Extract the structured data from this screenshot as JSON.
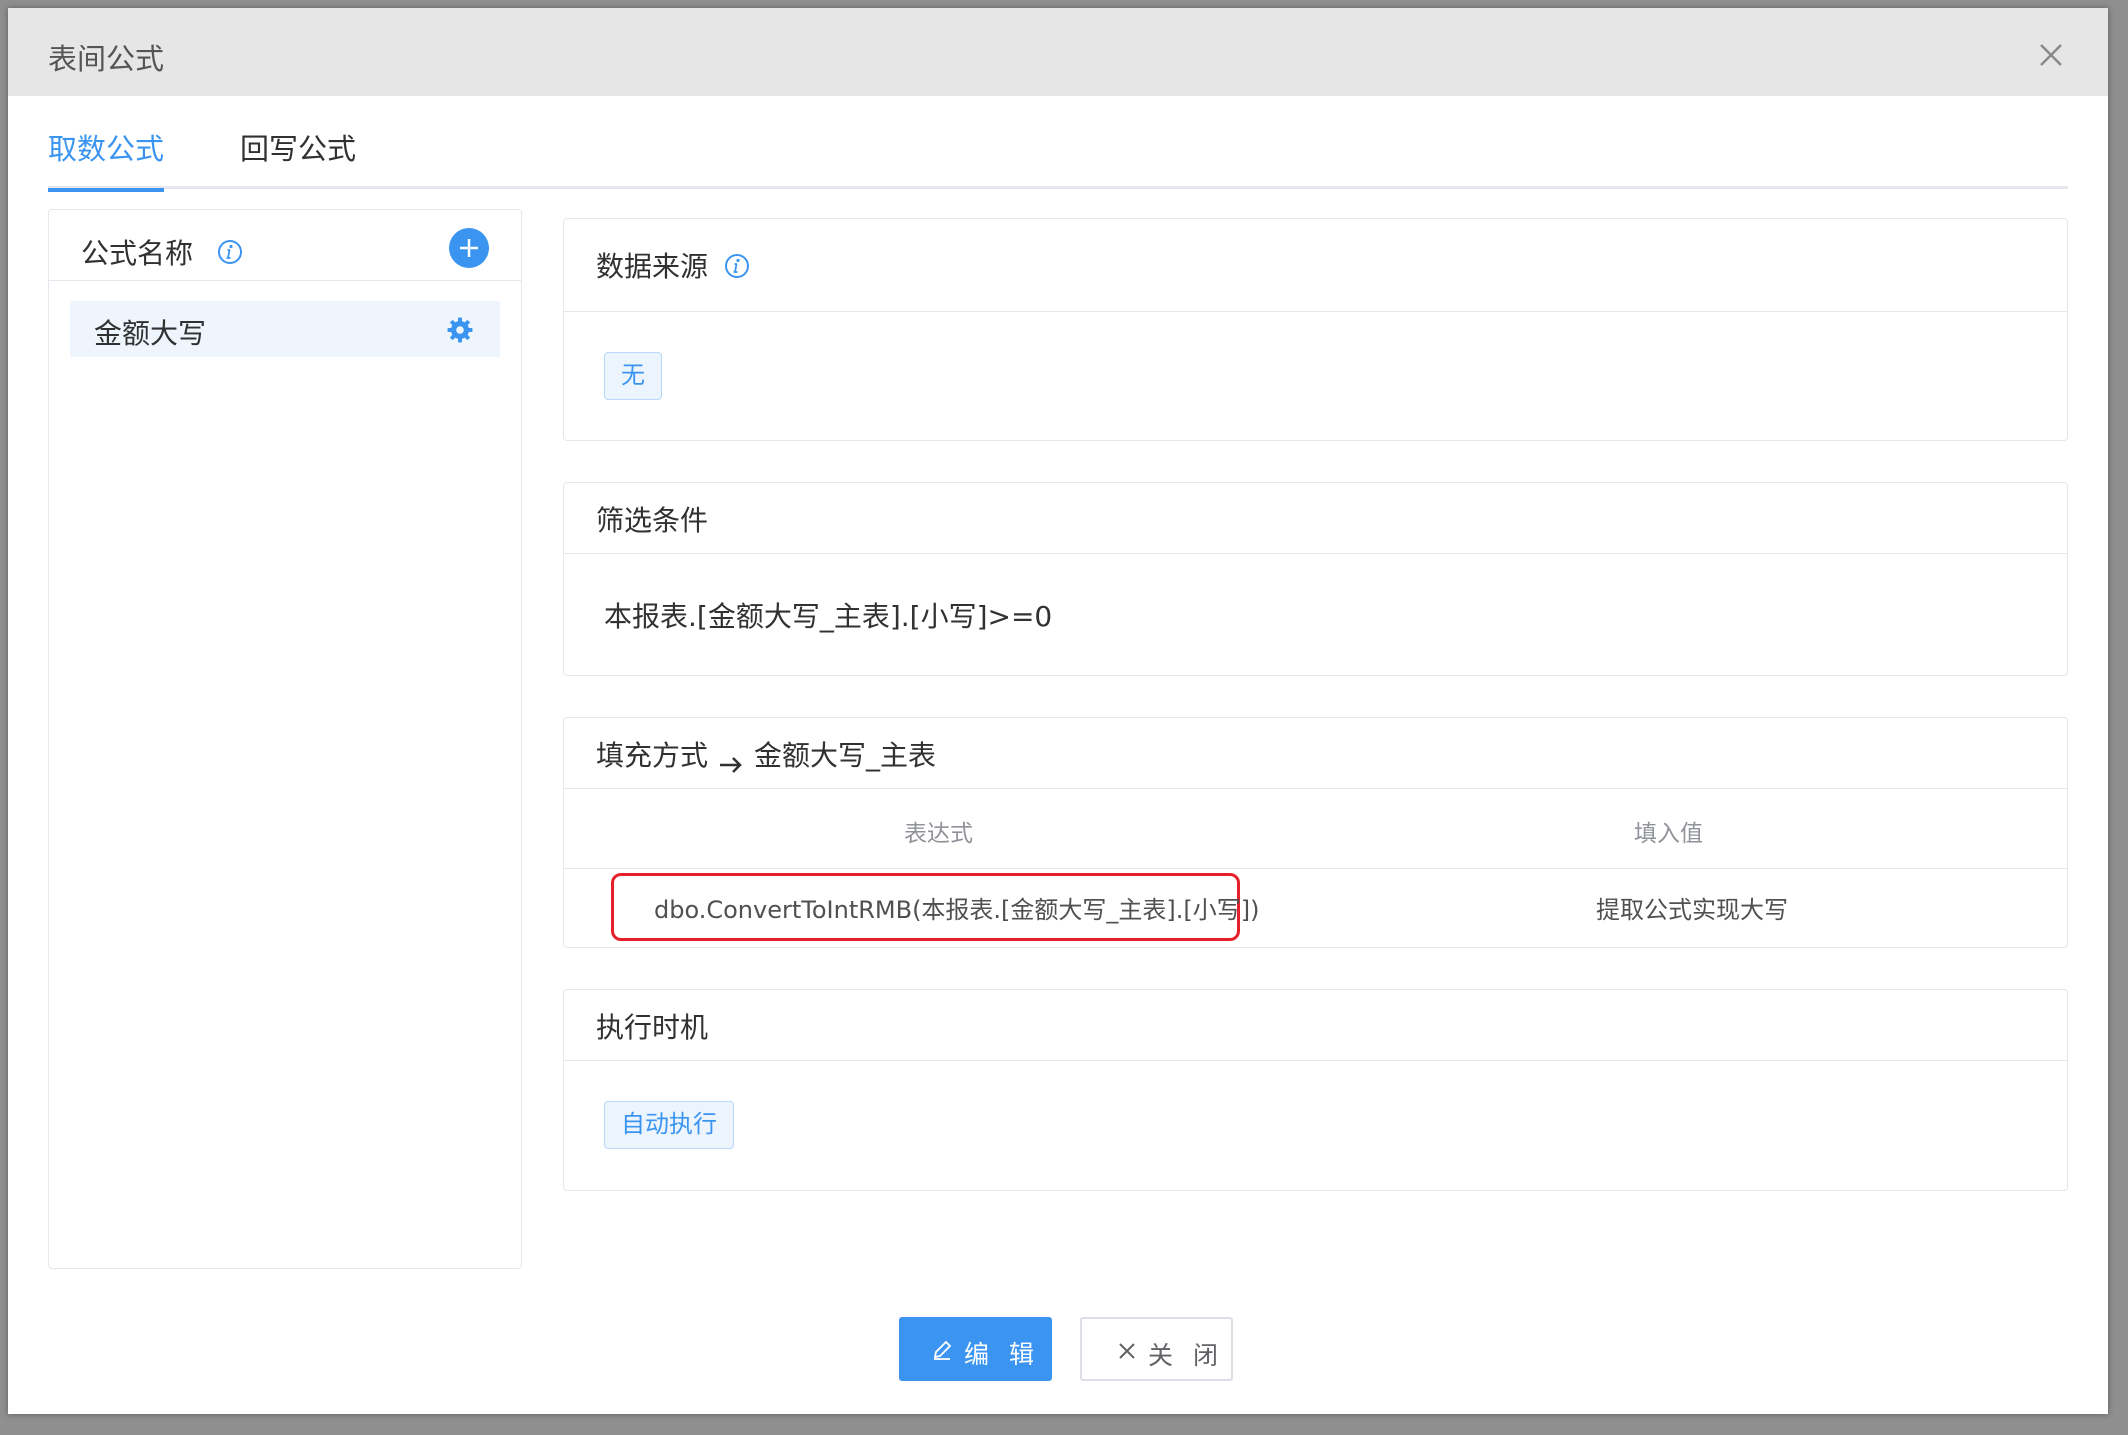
{
  "dialog": {
    "title": "表间公式",
    "close_icon": "close-icon"
  },
  "tabs": [
    {
      "label": "取数公式",
      "active": true
    },
    {
      "label": "回写公式",
      "active": false
    }
  ],
  "left_panel": {
    "header": "公式名称",
    "info_icon": "info-icon",
    "add_icon": "plus-icon",
    "items": [
      {
        "label": "金额大写",
        "icon": "gear-icon"
      }
    ]
  },
  "data_source": {
    "title": "数据来源",
    "tag": "无"
  },
  "filter": {
    "title": "筛选条件",
    "condition": "本报表.[金额大写_主表].[小写]>=0"
  },
  "fill": {
    "title": "填充方式",
    "target": "金额大写_主表",
    "columns": [
      "表达式",
      "填入值"
    ],
    "rows": [
      {
        "expression": "dbo.ConvertToIntRMB(本报表.[金额大写_主表].[小写])",
        "value": "提取公式实现大写"
      }
    ]
  },
  "timing": {
    "title": "执行时机",
    "tag": "自动执行"
  },
  "footer": {
    "edit_label": "编 辑",
    "close_label": "关 闭"
  },
  "colors": {
    "accent": "#3b95f0",
    "highlight": "#e5202a"
  }
}
